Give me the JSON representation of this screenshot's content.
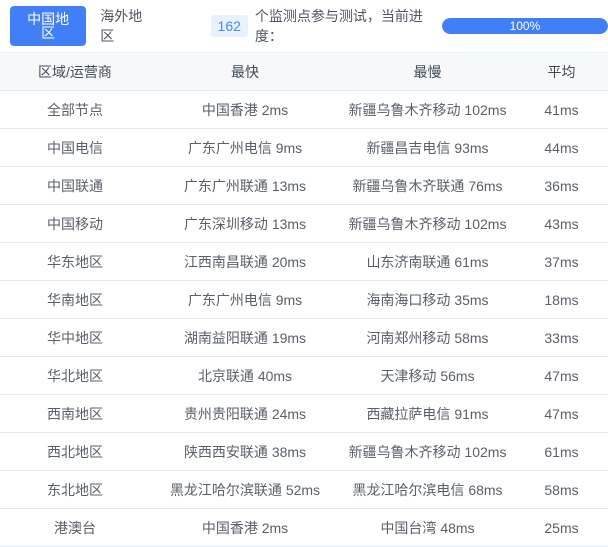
{
  "tabs": [
    {
      "label": "中国地区",
      "active": true
    },
    {
      "label": "海外地区",
      "active": false
    }
  ],
  "monitor": {
    "count": "162",
    "text_after_count": "个监测点参与测试，当前进度：",
    "progress_label": "100%",
    "progress_percent": 100
  },
  "table": {
    "headers": [
      "区域/运营商",
      "最快",
      "最慢",
      "平均"
    ],
    "rows": [
      [
        "全部节点",
        "中国香港 2ms",
        "新疆乌鲁木齐移动 102ms",
        "41ms"
      ],
      [
        "中国电信",
        "广东广州电信 9ms",
        "新疆昌吉电信 93ms",
        "44ms"
      ],
      [
        "中国联通",
        "广东广州联通 13ms",
        "新疆乌鲁木齐联通 76ms",
        "36ms"
      ],
      [
        "中国移动",
        "广东深圳移动 13ms",
        "新疆乌鲁木齐移动 102ms",
        "43ms"
      ],
      [
        "华东地区",
        "江西南昌联通 20ms",
        "山东济南联通 61ms",
        "37ms"
      ],
      [
        "华南地区",
        "广东广州电信 9ms",
        "海南海口移动 35ms",
        "18ms"
      ],
      [
        "华中地区",
        "湖南益阳联通 19ms",
        "河南郑州移动 58ms",
        "33ms"
      ],
      [
        "华北地区",
        "北京联通 40ms",
        "天津移动 56ms",
        "47ms"
      ],
      [
        "西南地区",
        "贵州贵阳联通 24ms",
        "西藏拉萨电信 91ms",
        "47ms"
      ],
      [
        "西北地区",
        "陕西西安联通 38ms",
        "新疆乌鲁木齐移动 102ms",
        "61ms"
      ],
      [
        "东北地区",
        "黑龙江哈尔滨联通 52ms",
        "黑龙江哈尔滨电信 68ms",
        "58ms"
      ],
      [
        "港澳台",
        "中国香港 2ms",
        "中国台湾 48ms",
        "25ms"
      ]
    ]
  },
  "colors": {
    "accent_blue": "#417ff7",
    "badge_bg": "#e8f1fe",
    "badge_text": "#4a86f7",
    "header_bg": "#f7f8fa",
    "row_border": "#e3e9f0"
  }
}
